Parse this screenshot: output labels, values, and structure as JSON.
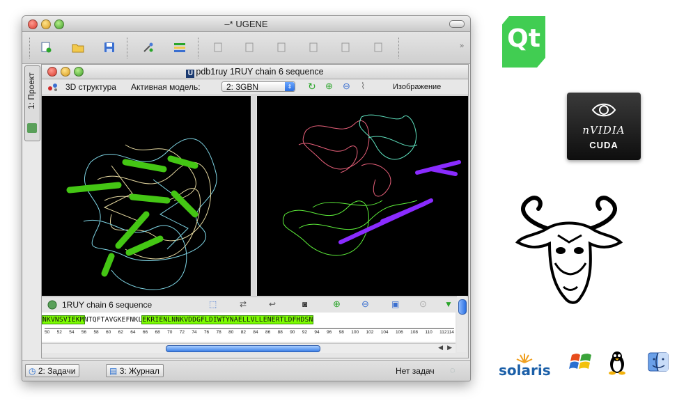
{
  "window": {
    "title": "–* UGENE"
  },
  "dock": {
    "project_tab": "1: Проект"
  },
  "subwindow": {
    "logo": "U",
    "title": "pdb1ruy 1RUY chain 6 sequence"
  },
  "panel": {
    "structure_label": "3D структура",
    "model_label": "Активная модель:",
    "model_value": "2: 3GBN",
    "image_label": "Изображение"
  },
  "sequence": {
    "header": "1RUY chain 6 sequence",
    "segments": [
      "NKVNSVIEKM",
      "NTQFTAVGKEFNKL",
      "EKRIENLNNKVDDGFLDIWTYNAELLVLLENERTLDFHDSN"
    ],
    "ruler": [
      "50",
      "52",
      "54",
      "56",
      "58",
      "60",
      "62",
      "64",
      "66",
      "68",
      "70",
      "72",
      "74",
      "76",
      "78",
      "80",
      "82",
      "84",
      "86",
      "88",
      "90",
      "92",
      "94",
      "96",
      "98",
      "100",
      "102",
      "104",
      "106",
      "108",
      "110",
      "112114"
    ]
  },
  "statusbar": {
    "tasks_button": "2: Задачи",
    "log_button": "3: Журнал",
    "status": "Нет задач"
  },
  "logos": {
    "qt": "Qt",
    "nvidia": "nVIDIA",
    "cuda": "CUDA",
    "solaris": "solaris"
  },
  "colors": {
    "sequence_highlight": "#7cfc00",
    "qt_green": "#41cd52",
    "view_background": "#000000"
  }
}
